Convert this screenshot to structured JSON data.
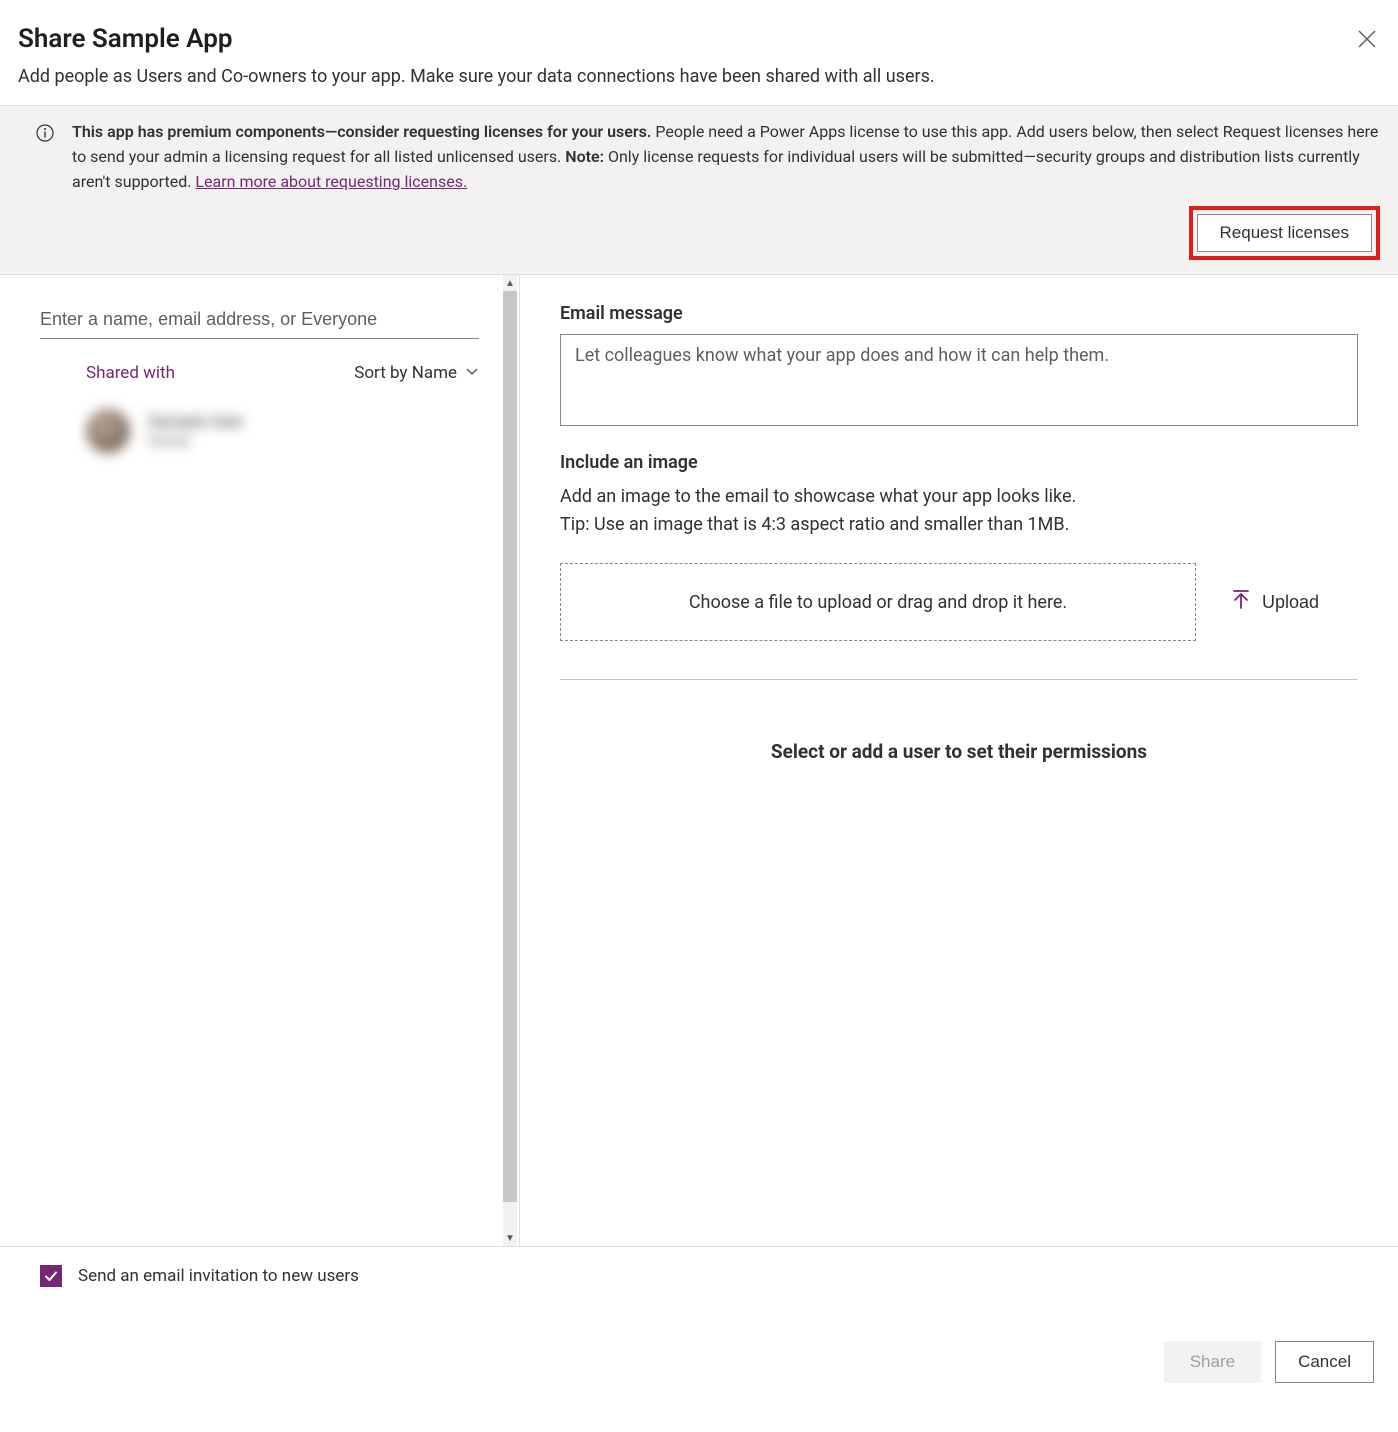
{
  "header": {
    "title": "Share Sample App",
    "subtitle": "Add people as Users and Co-owners to your app. Make sure your data connections have been shared with all users."
  },
  "banner": {
    "bold_lead": "This app has premium components—consider requesting licenses for your users.",
    "body_1": " People need a Power Apps license to use this app. Add users below, then select Request licenses here to send your admin a licensing request for all listed unlicensed users. ",
    "note_label": "Note:",
    "body_2": " Only license requests for individual users will be submitted—security groups and distribution lists currently aren't supported. ",
    "link_text": "Learn more about requesting licenses.",
    "button_label": "Request licenses"
  },
  "left": {
    "input_placeholder": "Enter a name, email address, or Everyone",
    "shared_with_label": "Shared with",
    "sort_label": "Sort by Name",
    "user": {
      "name": "Sample User",
      "role": "Owner"
    }
  },
  "right": {
    "email_label": "Email message",
    "email_placeholder": "Let colleagues know what your app does and how it can help them.",
    "image_label": "Include an image",
    "image_desc_1": "Add an image to the email to showcase what your app looks like.",
    "image_desc_2": "Tip: Use an image that is 4:3 aspect ratio and smaller than 1MB.",
    "dropzone_text": "Choose a file to upload or drag and drop it here.",
    "upload_label": "Upload",
    "perm_prompt": "Select or add a user to set their permissions"
  },
  "footer": {
    "email_opt_label": "Send an email invitation to new users",
    "share_label": "Share",
    "cancel_label": "Cancel"
  }
}
